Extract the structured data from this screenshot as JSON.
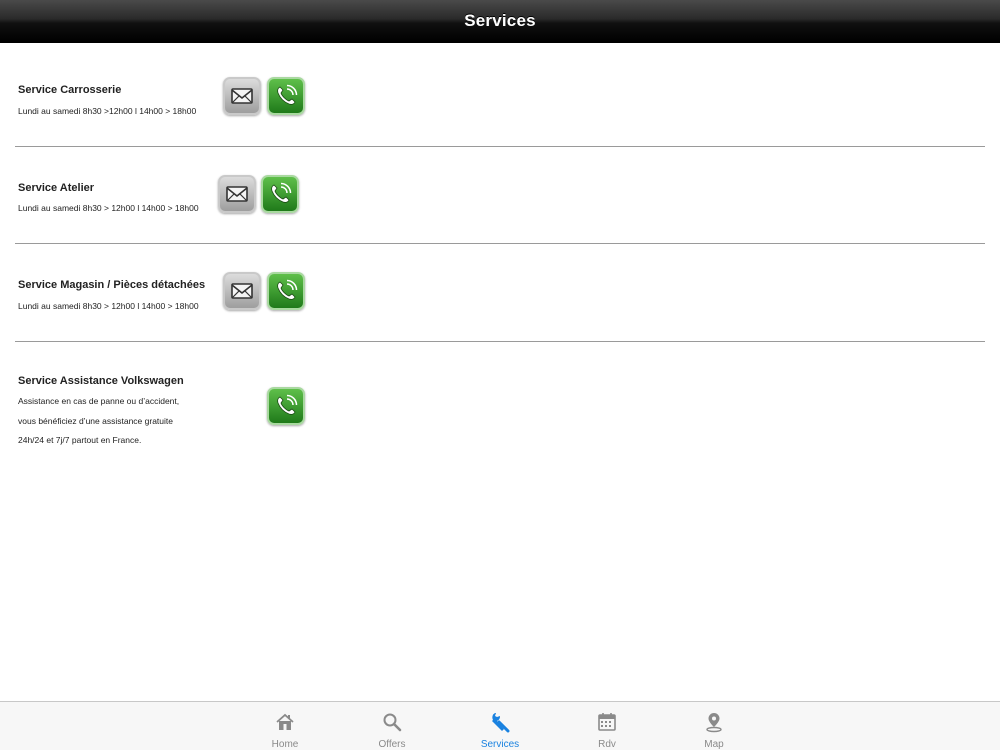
{
  "header": {
    "title": "Services"
  },
  "services": [
    {
      "title": "Service Carrosserie",
      "lines": [
        "Lundi au samedi 8h30 >12h00 l 14h00 > 18h00"
      ],
      "has_mail": true,
      "has_phone": true
    },
    {
      "title": "Service Atelier",
      "lines": [
        "Lundi au samedi 8h30 > 12h00 l 14h00 > 18h00"
      ],
      "has_mail": true,
      "has_phone": true
    },
    {
      "title": "Service Magasin / Pièces détachées",
      "lines": [
        "Lundi au samedi 8h30 > 12h00 l 14h00 > 18h00"
      ],
      "has_mail": true,
      "has_phone": true
    },
    {
      "title": "Service Assistance Volkswagen",
      "lines": [
        "Assistance en cas de panne ou d’accident,",
        "vous bénéficiez d’une assistance gratuite",
        "24h/24 et 7j/7 partout en France."
      ],
      "has_mail": false,
      "has_phone": true
    }
  ],
  "tabbar": {
    "tabs": [
      {
        "label": "Home",
        "icon": "home-icon",
        "active": false
      },
      {
        "label": "Offers",
        "icon": "search-icon",
        "active": false
      },
      {
        "label": "Services",
        "icon": "wrench-icon",
        "active": true
      },
      {
        "label": "Rdv",
        "icon": "calendar-icon",
        "active": false
      },
      {
        "label": "Map",
        "icon": "map-pin-icon",
        "active": false
      }
    ]
  },
  "colors": {
    "active_tab": "#1a82e0",
    "inactive_tab": "#8a8a8a",
    "phone_green": "#2e9a26",
    "mail_gray": "#9e9e9e"
  }
}
